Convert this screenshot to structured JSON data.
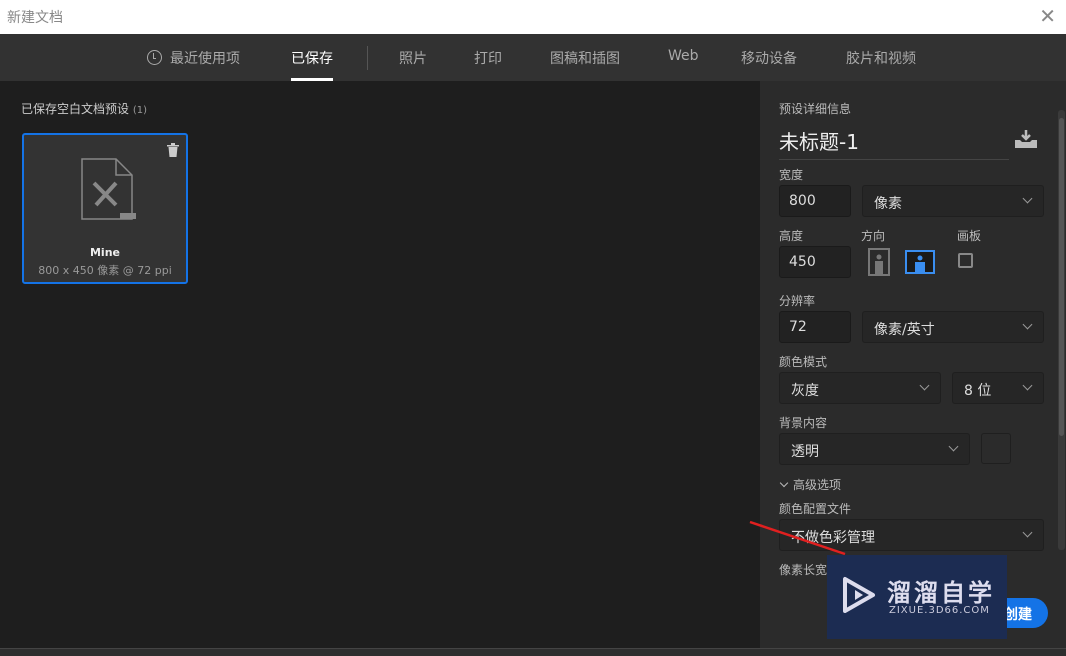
{
  "window": {
    "title": "新建文档",
    "close_icon": "close-icon"
  },
  "tabs": [
    {
      "label": "最近使用项",
      "icon": "clock-icon"
    },
    {
      "label": "已保存",
      "active": true
    },
    {
      "label": "照片"
    },
    {
      "label": "打印"
    },
    {
      "label": "图稿和插图"
    },
    {
      "label": "Web"
    },
    {
      "label": "移动设备"
    },
    {
      "label": "胶片和视频"
    }
  ],
  "saved": {
    "heading": "已保存空白文档预设",
    "count": "(1)",
    "presets": [
      {
        "name": "Mine",
        "meta": "800 x 450 像素 @ 72 ppi"
      }
    ]
  },
  "details": {
    "heading": "预设详细信息",
    "doc_name": "未标题-1",
    "width_label": "宽度",
    "width": "800",
    "width_unit": "像素",
    "height_label": "高度",
    "height": "450",
    "orientation_label": "方向",
    "orientation": "landscape",
    "artboard_label": "画板",
    "artboard": false,
    "resolution_label": "分辨率",
    "resolution": "72",
    "resolution_unit": "像素/英寸",
    "color_mode_label": "颜色模式",
    "color_mode": "灰度",
    "bit_depth": "8 位",
    "background_label": "背景内容",
    "background": "透明",
    "advanced_label": "高级选项",
    "color_profile_label": "颜色配置文件",
    "color_profile": "不做色彩管理",
    "pixel_aspect_label": "像素长宽",
    "create_label": "创建"
  },
  "watermark": {
    "cn": "溜溜自学",
    "en": "ZIXUE.3D66.COM"
  },
  "colors": {
    "accent": "#1473e6",
    "panel": "#2b2b2b",
    "tabbar": "#323232"
  }
}
